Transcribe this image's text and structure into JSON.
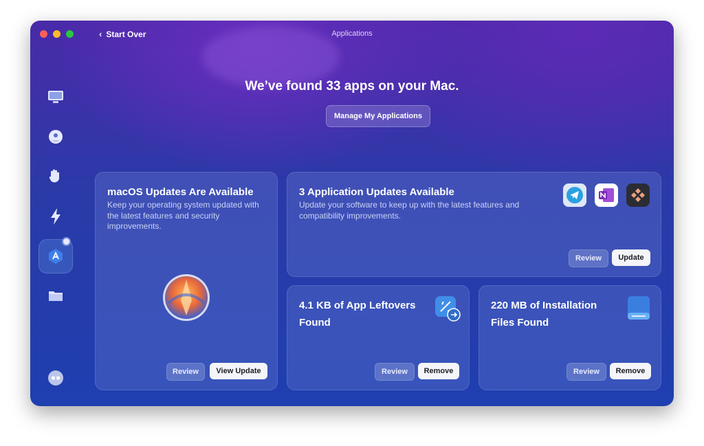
{
  "window": {
    "title": "Applications"
  },
  "nav": {
    "back_label": "Start Over"
  },
  "sidebar": {
    "items": [
      {
        "name": "cleanup",
        "icon": "display-icon"
      },
      {
        "name": "protection",
        "icon": "shield-ball-icon"
      },
      {
        "name": "privacy",
        "icon": "hand-icon"
      },
      {
        "name": "speed",
        "icon": "bolt-icon"
      },
      {
        "name": "applications",
        "icon": "app-store-icon",
        "active": true
      },
      {
        "name": "files",
        "icon": "folder-icon"
      }
    ],
    "bottom_icon": "assistant-icon"
  },
  "main": {
    "headline": "We’ve found 33 apps on your Mac.",
    "manage_label": "Manage My Applications"
  },
  "cards": {
    "macos": {
      "title": "macOS Updates Are Available",
      "description": "Keep your operating system updated with the latest features and security improvements.",
      "review": "Review",
      "action": "View Update"
    },
    "app_updates": {
      "title": "3 Application Updates Available",
      "description": "Update your software to keep up with the latest features and compatibility improvements.",
      "review": "Review",
      "action": "Update",
      "icons": [
        "telegram-icon",
        "onenote-icon",
        "setapp-icon"
      ]
    },
    "leftovers": {
      "title": "4.1 KB of App Leftovers Found",
      "review": "Review",
      "action": "Remove"
    },
    "installation": {
      "title": "220 MB of Installation Files Found",
      "review": "Review",
      "action": "Remove"
    }
  },
  "colors": {
    "accent": "#2a3aa8",
    "window_bg_top": "#4a2aa8",
    "window_bg_bottom": "#1f3fb0",
    "button_light": "#f4f5f8"
  }
}
